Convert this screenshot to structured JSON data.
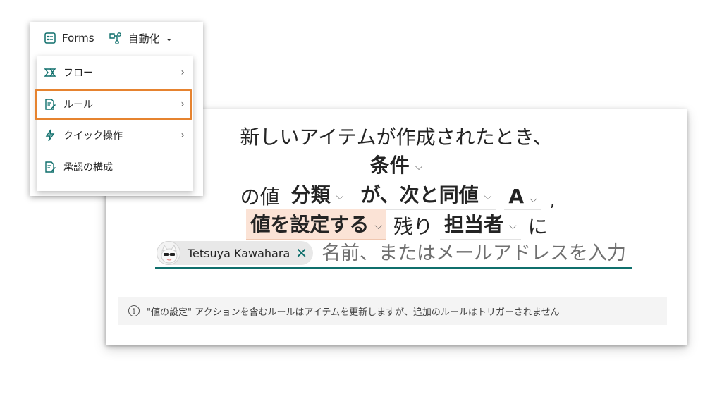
{
  "toolbar": {
    "forms_label": "Forms",
    "automate_label": "自動化"
  },
  "menu": {
    "items": [
      {
        "label": "フロー",
        "icon": "flow-icon",
        "has_submenu": true
      },
      {
        "label": "ルール",
        "icon": "rule-icon",
        "has_submenu": true,
        "selected": true
      },
      {
        "label": "クイック操作",
        "icon": "lightning-icon",
        "has_submenu": true
      },
      {
        "label": "承認の構成",
        "icon": "approval-icon",
        "has_submenu": false
      }
    ]
  },
  "rule": {
    "line1": "新しいアイテムが作成されたとき、",
    "condition_label": "条件",
    "prefix_column": "の値",
    "column_value": "分類",
    "operator_value": "が、次と同値",
    "compare_value": "A",
    "comma": ",",
    "action_value": "値を設定する",
    "remaining_text": "残り",
    "target_column": "担当者",
    "suffix_text": "に",
    "person_name": "Tetsuya Kawahara",
    "person_input_placeholder": "名前、またはメールアドレスを入力",
    "info_text": "\"値の設定\" アクションを含むルールはアイテムを更新しますが、追加のルールはトリガーされません"
  },
  "colors": {
    "accent_orange": "#e6832f",
    "teal": "#0f6f6c",
    "highlight": "#fbe3d6"
  }
}
